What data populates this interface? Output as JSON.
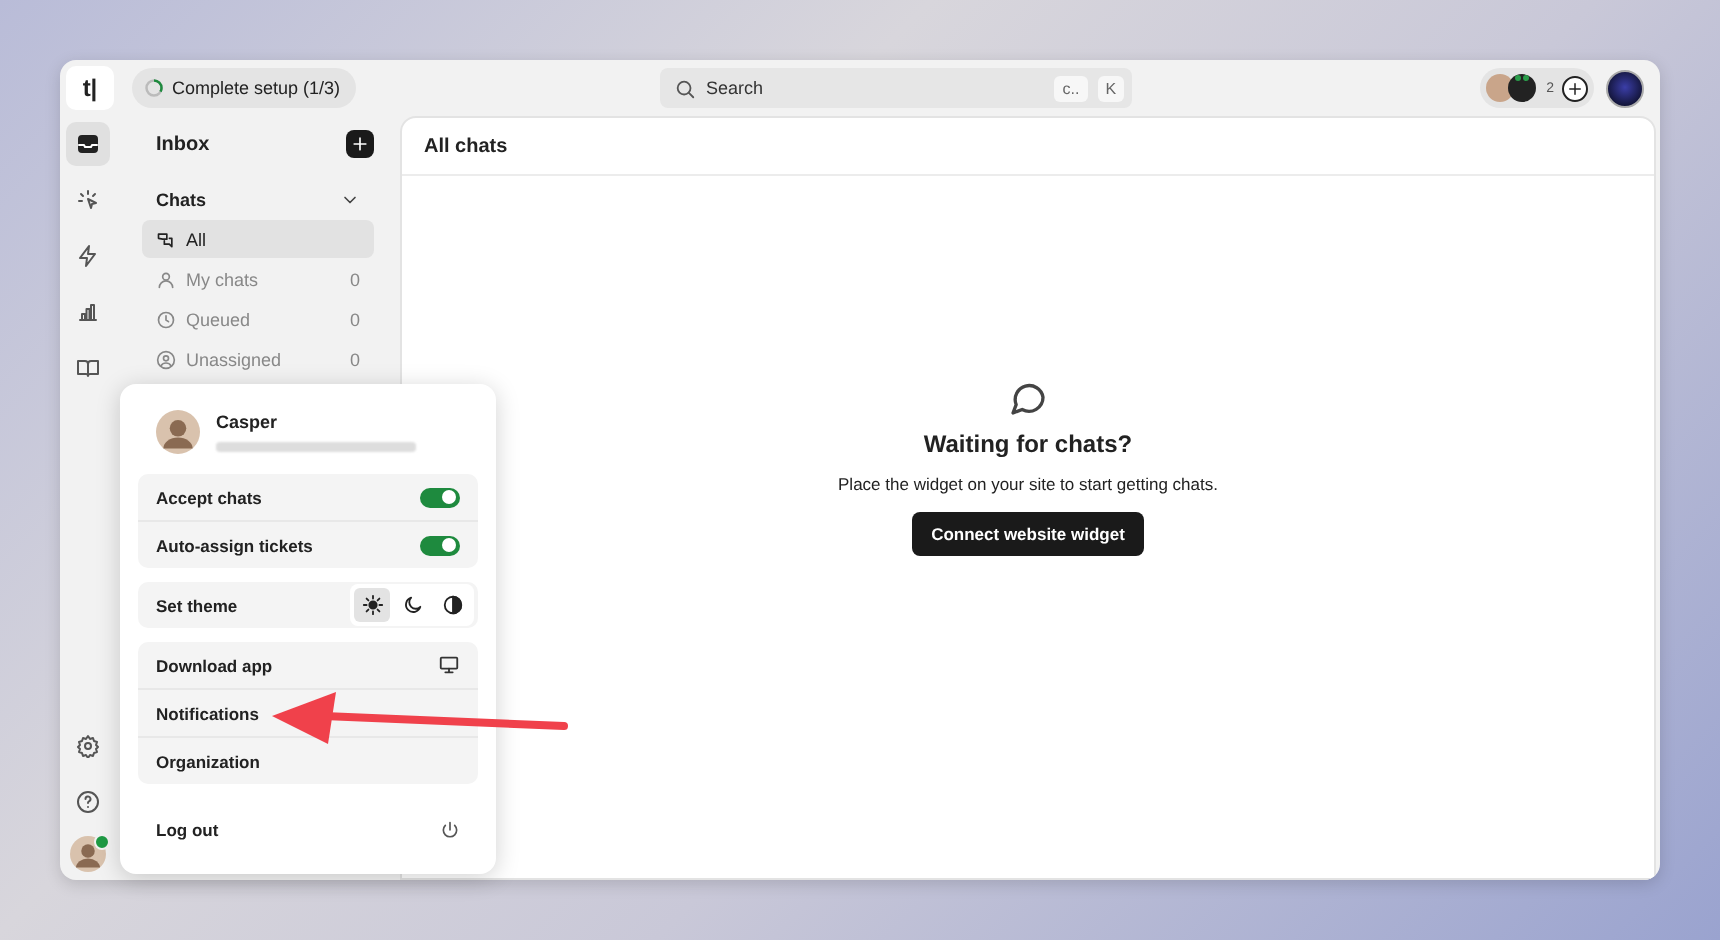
{
  "topbar": {
    "logo": "t|",
    "setup": {
      "label": "Complete setup (1/3)",
      "level": 0.33
    },
    "search": {
      "placeholder": "Search",
      "keys": [
        "c..",
        "K"
      ]
    },
    "team": {
      "count": "2"
    }
  },
  "rail": {
    "items": [
      {
        "selected": true
      },
      {
        "selected": false
      },
      {
        "selected": false
      },
      {
        "selected": false
      },
      {
        "selected": false
      }
    ],
    "user": {
      "online": true
    }
  },
  "sidebar": {
    "title": "Inbox",
    "section": {
      "label": "Chats",
      "expanded": true
    },
    "items": [
      {
        "label": "All",
        "selected": true
      },
      {
        "label": "My chats",
        "count": "0",
        "selected": false
      },
      {
        "label": "Queued",
        "count": "0",
        "selected": false
      },
      {
        "label": "Unassigned",
        "count": "0",
        "selected": false
      }
    ]
  },
  "main": {
    "title": "All chats",
    "empty": {
      "title": "Waiting for chats?",
      "text": "Place the widget on your site to start getting chats.",
      "button": "Connect website widget"
    }
  },
  "menu": {
    "name": "Casper",
    "toggles": [
      {
        "label": "Accept chats",
        "on": true
      },
      {
        "label": "Auto-assign tickets",
        "on": true
      }
    ],
    "theme": {
      "label": "Set theme",
      "options": [
        {
          "selected": true
        },
        {
          "selected": false
        },
        {
          "selected": false
        }
      ]
    },
    "links": [
      "Download app",
      "Notifications",
      "Organization"
    ],
    "logout": "Log out"
  }
}
